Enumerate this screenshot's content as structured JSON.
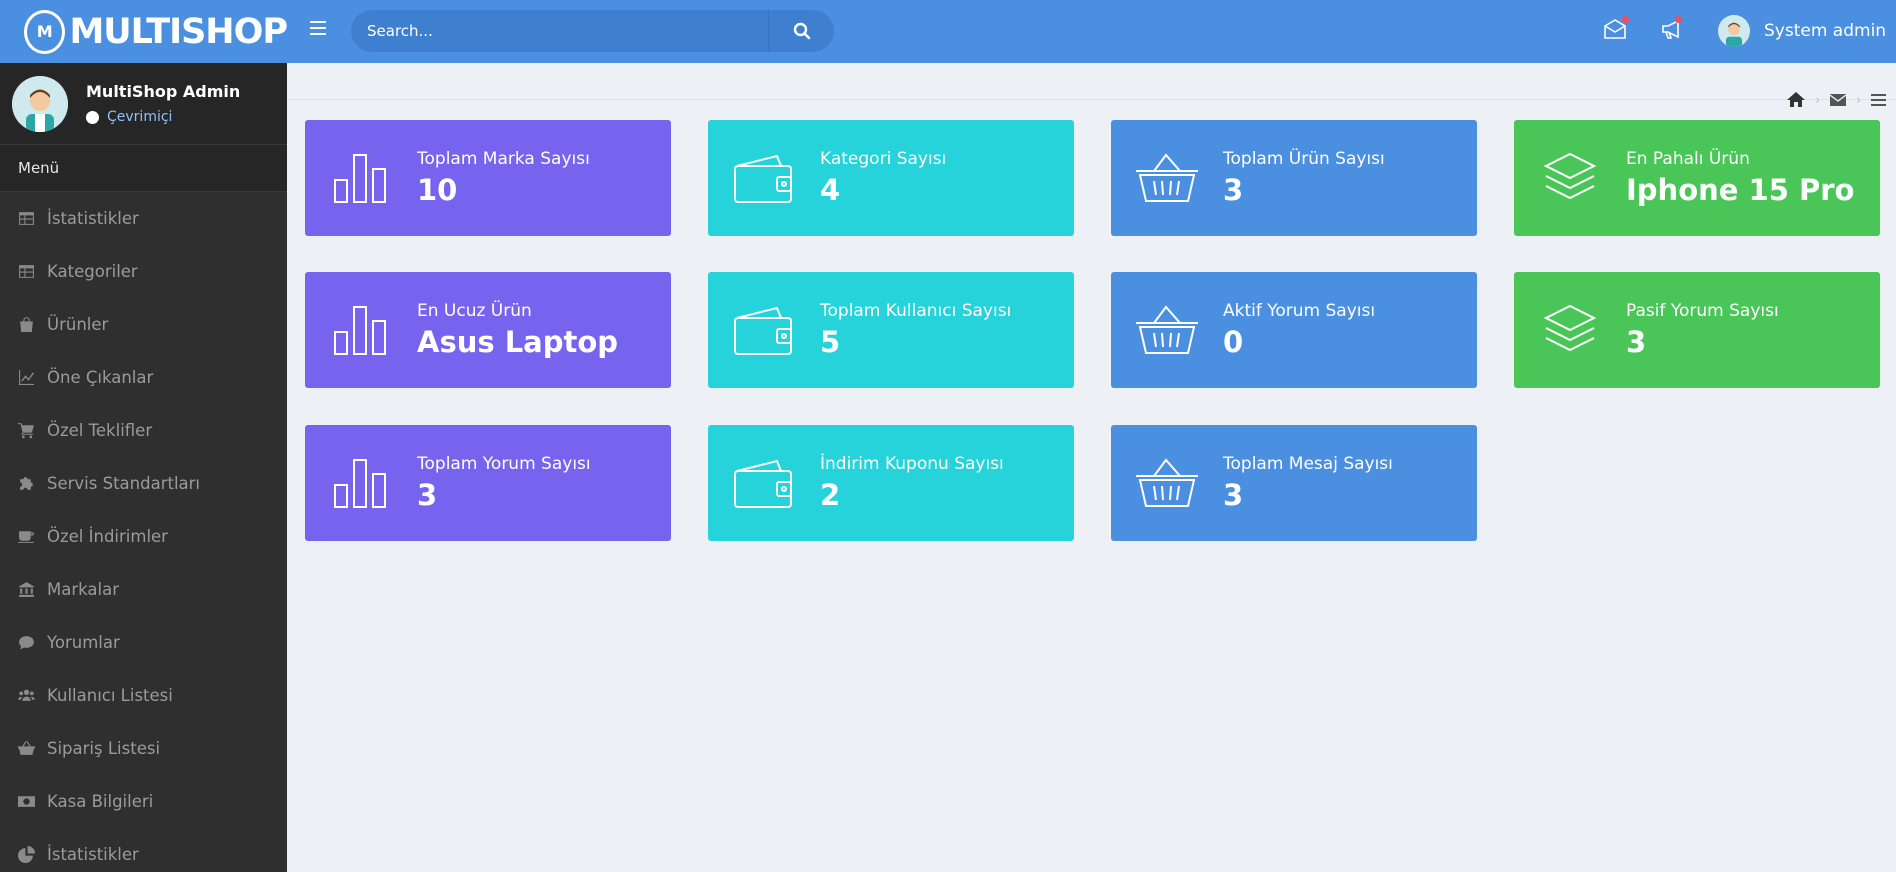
{
  "brand": {
    "name": "MULTISHOP",
    "mark": "M"
  },
  "profile": {
    "name": "MultiShop Admin",
    "status": "Çevrimiçi"
  },
  "menu": {
    "header": "Menü",
    "items": [
      {
        "label": "İstatistikler",
        "icon": "table-icon"
      },
      {
        "label": "Kategoriler",
        "icon": "table-icon"
      },
      {
        "label": "Ürünler",
        "icon": "shopping-bag-icon"
      },
      {
        "label": "Öne Çıkanlar",
        "icon": "line-chart-icon"
      },
      {
        "label": "Özel Teklifler",
        "icon": "cart-icon"
      },
      {
        "label": "Servis Standartları",
        "icon": "puzzle-icon"
      },
      {
        "label": "Özel İndirimler",
        "icon": "coffee-icon"
      },
      {
        "label": "Markalar",
        "icon": "bank-icon"
      },
      {
        "label": "Yorumlar",
        "icon": "comment-icon"
      },
      {
        "label": "Kullanıcı Listesi",
        "icon": "users-icon"
      },
      {
        "label": "Sipariş Listesi",
        "icon": "basket-icon"
      },
      {
        "label": "Kasa Bilgileri",
        "icon": "money-icon"
      },
      {
        "label": "İstatistikler",
        "icon": "pie-chart-icon"
      }
    ]
  },
  "topbar": {
    "search_placeholder": "Search...",
    "user_name": "System admin"
  },
  "cards": [
    {
      "label": "Toplam Marka Sayısı",
      "value": "10",
      "color": "#7664ef",
      "icon": "bar-chart-icon"
    },
    {
      "label": "Kategori Sayısı",
      "value": "4",
      "color": "#26d3db",
      "icon": "wallet-icon"
    },
    {
      "label": "Toplam Ürün Sayısı",
      "value": "3",
      "color": "#4a8fe0",
      "icon": "basket-icon"
    },
    {
      "label": "En Pahalı Ürün",
      "value": "Iphone 15 Pro",
      "color": "#4ac658",
      "icon": "layers-icon"
    },
    {
      "label": "En Ucuz Ürün",
      "value": "Asus Laptop",
      "color": "#7664ef",
      "icon": "bar-chart-icon"
    },
    {
      "label": "Toplam Kullanıcı Sayısı",
      "value": "5",
      "color": "#26d3db",
      "icon": "wallet-icon"
    },
    {
      "label": "Aktif Yorum Sayısı",
      "value": "0",
      "color": "#4a8fe0",
      "icon": "basket-icon"
    },
    {
      "label": "Pasif Yorum Sayısı",
      "value": "3",
      "color": "#4ac658",
      "icon": "layers-icon"
    },
    {
      "label": "Toplam Yorum Sayısı",
      "value": "3",
      "color": "#7664ef",
      "icon": "bar-chart-icon"
    },
    {
      "label": "İndirim Kuponu Sayısı",
      "value": "2",
      "color": "#26d3db",
      "icon": "wallet-icon"
    },
    {
      "label": "Toplam Mesaj Sayısı",
      "value": "3",
      "color": "#4a8fe0",
      "icon": "basket-icon"
    }
  ]
}
